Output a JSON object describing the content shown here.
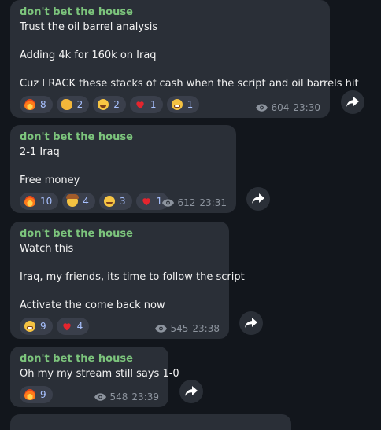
{
  "messages": [
    {
      "author": "don't bet the house",
      "lines": [
        "Trust the oil barrel analysis",
        "",
        "Adding 4k for 160k on Iraq",
        "",
        "Cuz I RACK these stacks of cash when the script and oil barrels hit"
      ],
      "reactions": [
        {
          "emoji": "fire-icon",
          "count": "8"
        },
        {
          "emoji": "clap-icon",
          "count": "2"
        },
        {
          "emoji": "laugh-icon",
          "count": "2"
        },
        {
          "emoji": "heart-icon",
          "count": "1"
        },
        {
          "emoji": "grin-icon",
          "count": "1"
        }
      ],
      "views": "604",
      "time": "23:30"
    },
    {
      "author": "don't bet the house",
      "lines": [
        "2-1 Iraq",
        "",
        "Free money"
      ],
      "reactions": [
        {
          "emoji": "fire-icon",
          "count": "10"
        },
        {
          "emoji": "cowboy-icon",
          "count": "4"
        },
        {
          "emoji": "laugh-icon",
          "count": "3"
        },
        {
          "emoji": "heart-icon",
          "count": "1"
        }
      ],
      "views": "612",
      "time": "23:31"
    },
    {
      "author": "don't bet the house",
      "lines": [
        "Watch this",
        "",
        "Iraq, my friends, its time to follow the script",
        "",
        "Activate the come back now"
      ],
      "reactions": [
        {
          "emoji": "grin-icon",
          "count": "9"
        },
        {
          "emoji": "heart-icon",
          "count": "4"
        }
      ],
      "views": "545",
      "time": "23:38"
    },
    {
      "author": "don't bet the house",
      "lines": [
        "Oh my my stream still says 1-0"
      ],
      "reactions": [
        {
          "emoji": "fire-icon",
          "count": "9"
        }
      ],
      "views": "548",
      "time": "23:39"
    }
  ],
  "colors": {
    "background": "#12161c",
    "bubble": "#2a2f37",
    "author": "#7cc47c",
    "reaction_bg": "#3a3f4b",
    "reaction_count": "#a8c1ff",
    "meta": "#8d949e"
  }
}
